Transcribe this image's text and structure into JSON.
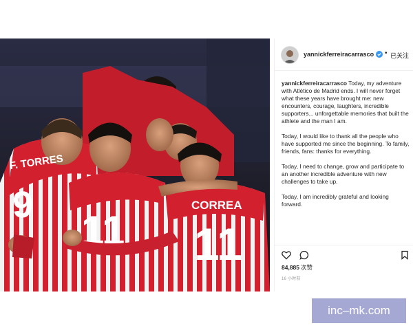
{
  "post": {
    "username": "yannickferreiracarrasco",
    "follow_status": "已关注",
    "caption_user": "yannickferreiracarrasco",
    "caption_paragraphs": [
      "Today, my adventure with Atlético de Madrid ends. I will never forget what these years have brought me: new encounters, courage, laughters, incredible supporters... unforgettable memories that built the athlete and the man I am.",
      "Today, I would like to thank all the people who have supported me since the beginning. To family, friends, fans: thanks for everything.",
      "Today, I need to change, grow and participate to an another incredible adventure with new challenges to take up.",
      "Today, I am incredibly grateful and looking forward."
    ],
    "likes_count": "84,885",
    "likes_label": "次赞",
    "timestamp": "16 小时前"
  },
  "photo": {
    "jersey_names": [
      "F. TORRES",
      "CORREA"
    ],
    "jersey_numbers": [
      "9",
      "11",
      "11"
    ]
  },
  "icons": {
    "verified": "verified-badge-icon",
    "like": "heart-icon",
    "comment": "comment-icon",
    "save": "bookmark-icon"
  },
  "colors": {
    "verified_blue": "#3897f0",
    "kit_red": "#d3202f",
    "kit_white": "#f2f2f2"
  },
  "watermark": "inc–mk.com"
}
